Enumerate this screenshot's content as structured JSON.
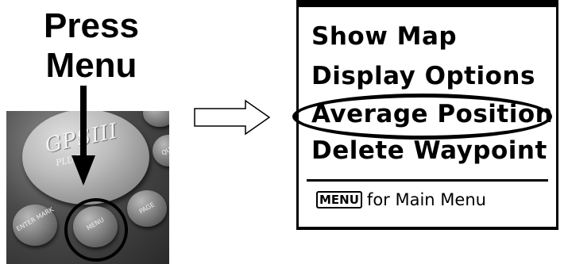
{
  "instruction": {
    "line1": "Press",
    "line2": "Menu"
  },
  "device": {
    "brand": "GPSIII",
    "brand_sub": "PLUS",
    "buttons": {
      "enter": "ENTER MARK",
      "menu": "MENU",
      "page": "PAGE",
      "quit": "QU"
    }
  },
  "screen": {
    "menu_items": [
      "Show Map",
      "Display Options",
      "Average Position",
      "Delete Waypoint"
    ],
    "highlighted_item": "Average Position",
    "footer": {
      "key": "MENU",
      "text": "for Main Menu"
    }
  },
  "colors": {
    "ink": "#000000",
    "background": "#ffffff"
  }
}
